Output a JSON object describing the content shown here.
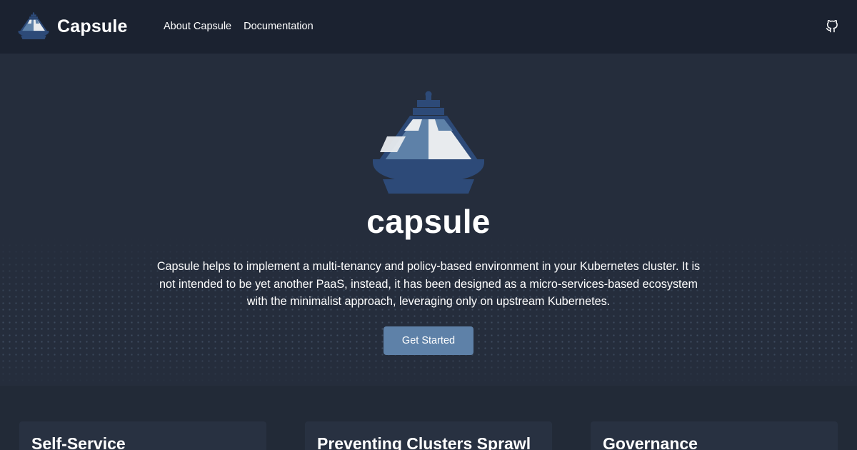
{
  "navbar": {
    "brand_name": "Capsule",
    "links": [
      "About Capsule",
      "Documentation"
    ],
    "github_icon": "github-icon"
  },
  "hero": {
    "title": "capsule",
    "description": "Capsule helps to implement a multi-tenancy and policy-based environment in your Kubernetes cluster. It is not intended to be yet another PaaS, instead, it has been designed as a micro-services-based ecosystem with the minimalist approach, leveraging only on upstream Kubernetes.",
    "cta_label": "Get Started"
  },
  "features": [
    {
      "title": "Self-Service"
    },
    {
      "title": "Preventing Clusters Sprawl"
    },
    {
      "title": "Governance"
    }
  ],
  "colors": {
    "navbar_bg": "#1b2230",
    "hero_bg": "#252d3c",
    "accent": "#5e81a8",
    "logo_light": "#e8ebee",
    "logo_mid": "#5e81a8",
    "logo_dark": "#2d4a78"
  }
}
